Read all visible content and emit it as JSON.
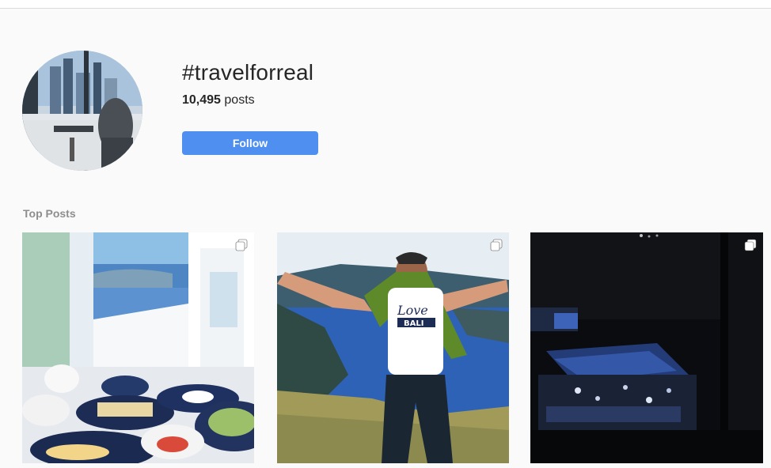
{
  "hashtag": {
    "name": "#travelforreal",
    "post_count": "10,495",
    "post_count_label": "posts",
    "follow_label": "Follow"
  },
  "top_posts": {
    "title": "Top Posts",
    "items": [
      {
        "subject": "santorini breakfast table with sea view",
        "multiple_icon": "carousel-icon"
      },
      {
        "subject": "man with arms outstretched, I Love Bali shirt, caldera behind",
        "multiple_icon": "carousel-icon"
      },
      {
        "subject": "dark night club interior with blue lights",
        "multiple_icon": "carousel-icon"
      }
    ]
  },
  "colors": {
    "accent": "#4e8ff0",
    "background": "#fafafa",
    "muted_text": "#8e8e8e"
  }
}
